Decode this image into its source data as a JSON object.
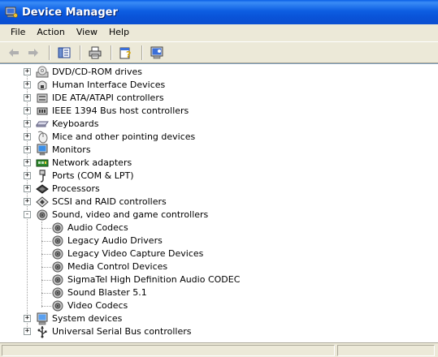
{
  "window": {
    "title": "Device Manager"
  },
  "menu": [
    "File",
    "Action",
    "View",
    "Help"
  ],
  "toolbar": {
    "buttons": [
      "back-icon",
      "forward-icon",
      "show-hide-tree-icon",
      "print-icon",
      "help-properties-icon",
      "scan-hardware-icon"
    ]
  },
  "tree": {
    "items": [
      {
        "label": "DVD/CD-ROM drives",
        "icon": "cdrom-icon",
        "expander": "+"
      },
      {
        "label": "Human Interface Devices",
        "icon": "hid-icon",
        "expander": "+"
      },
      {
        "label": "IDE ATA/ATAPI controllers",
        "icon": "ide-controller-icon",
        "expander": "+"
      },
      {
        "label": "IEEE 1394 Bus host controllers",
        "icon": "firewire-icon",
        "expander": "+"
      },
      {
        "label": "Keyboards",
        "icon": "keyboard-icon",
        "expander": "+"
      },
      {
        "label": "Mice and other pointing devices",
        "icon": "mouse-icon",
        "expander": "+"
      },
      {
        "label": "Monitors",
        "icon": "monitor-icon",
        "expander": "+"
      },
      {
        "label": "Network adapters",
        "icon": "network-adapter-icon",
        "expander": "+"
      },
      {
        "label": "Ports (COM & LPT)",
        "icon": "port-icon",
        "expander": "+"
      },
      {
        "label": "Processors",
        "icon": "processor-icon",
        "expander": "+"
      },
      {
        "label": "SCSI and RAID controllers",
        "icon": "scsi-icon",
        "expander": "+"
      },
      {
        "label": "Sound, video and game controllers",
        "icon": "sound-icon",
        "expander": "-"
      },
      {
        "label": "System devices",
        "icon": "system-devices-icon",
        "expander": "+"
      },
      {
        "label": "Universal Serial Bus controllers",
        "icon": "usb-icon",
        "expander": "+"
      }
    ],
    "sound_children": [
      "Audio Codecs",
      "Legacy Audio Drivers",
      "Legacy Video Capture Devices",
      "Media Control Devices",
      "SigmaTel High Definition Audio CODEC",
      "Sound Blaster 5.1",
      "Video Codecs"
    ]
  }
}
